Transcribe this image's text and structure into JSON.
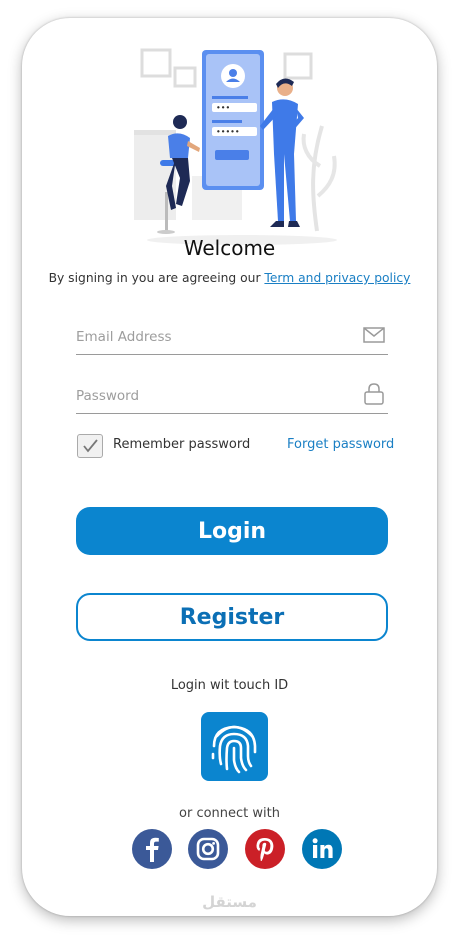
{
  "welcome": "Welcome",
  "terms": {
    "prefix": "By signing in you are agreeing our ",
    "link": "Term and privacy policy"
  },
  "email": {
    "placeholder": "Email Address",
    "icon": "mail-icon"
  },
  "password": {
    "placeholder": "Password",
    "icon": "lock-icon"
  },
  "remember": {
    "label": "Remember password",
    "checked": true
  },
  "forget": "Forget password",
  "login_label": "Login",
  "register_label": "Register",
  "touch_label": "Login wit touch ID",
  "connect_label": "or connect with",
  "social": [
    {
      "name": "facebook",
      "icon": "facebook-icon",
      "color": "#3b5998"
    },
    {
      "name": "instagram",
      "icon": "instagram-icon",
      "color": "#3b5998"
    },
    {
      "name": "pinterest",
      "icon": "pinterest-icon",
      "color": "#cb2027"
    },
    {
      "name": "linkedin",
      "icon": "linkedin-icon",
      "color": "#0077b5"
    }
  ],
  "colors": {
    "primary": "#0b85cf",
    "link": "#1a7fc4"
  },
  "watermark": "مستقل"
}
